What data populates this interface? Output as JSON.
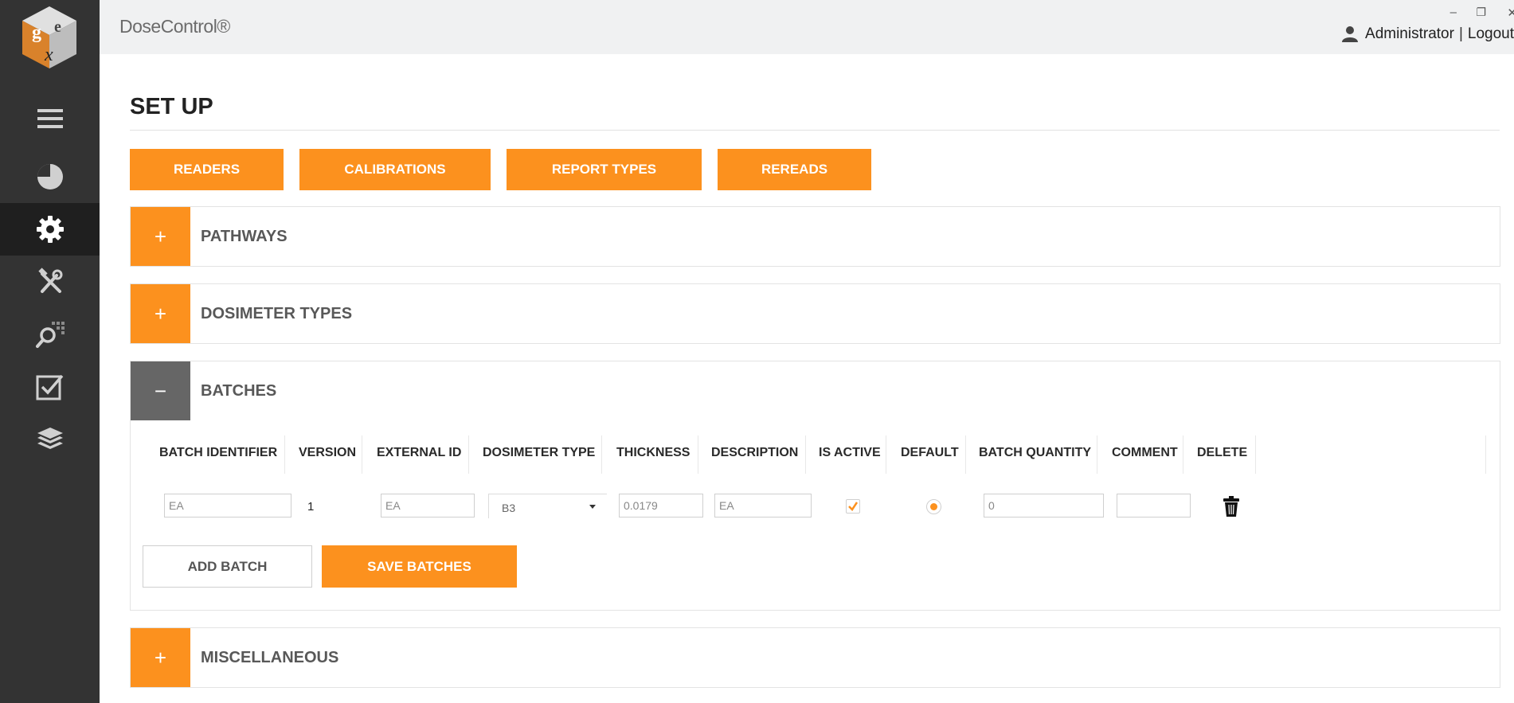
{
  "app": {
    "title": "DoseControl®"
  },
  "window": {
    "minimize": "–",
    "restore": "❐",
    "close": "✕"
  },
  "user": {
    "name": "Administrator",
    "separator": "|",
    "logout": "Logout"
  },
  "nav": [
    {
      "icon": "menu-icon"
    },
    {
      "icon": "pie-chart-icon"
    },
    {
      "icon": "gear-icon",
      "active": true
    },
    {
      "icon": "tools-icon"
    },
    {
      "icon": "search-grid-icon"
    },
    {
      "icon": "checklist-icon"
    },
    {
      "icon": "layers-icon"
    }
  ],
  "page": {
    "title": "SET UP"
  },
  "tabs": {
    "readers": "READERS",
    "calibrations": "CALIBRATIONS",
    "report_types": "REPORT TYPES",
    "rereads": "REREADS"
  },
  "panels": {
    "pathways": {
      "label": "PATHWAYS",
      "toggle": "+"
    },
    "dosimeter_types": {
      "label": "DOSIMETER TYPES",
      "toggle": "+"
    },
    "batches": {
      "label": "BATCHES",
      "toggle": "−"
    },
    "miscellaneous": {
      "label": "MISCELLANEOUS",
      "toggle": "+"
    }
  },
  "batches_table": {
    "headers": {
      "batch_identifier": "BATCH IDENTIFIER",
      "version": "VERSION",
      "external_id": "EXTERNAL ID",
      "dosimeter_type": "DOSIMETER TYPE",
      "thickness": "THICKNESS",
      "description": "DESCRIPTION",
      "is_active": "IS ACTIVE",
      "default": "DEFAULT",
      "batch_quantity": "BATCH QUANTITY",
      "comment": "COMMENT",
      "delete": "DELETE"
    },
    "row": {
      "batch_identifier": "EA",
      "version": "1",
      "external_id": "EA",
      "dosimeter_type": "B3",
      "thickness": "0.0179",
      "description": "EA",
      "is_active": true,
      "default": true,
      "batch_quantity": "0",
      "comment": ""
    }
  },
  "actions": {
    "add_batch": "ADD BATCH",
    "save_batches": "SAVE BATCHES"
  },
  "colors": {
    "accent": "#fc911e",
    "sidebar": "#333333",
    "sidebar_active": "#1f1f1f",
    "collapse_toggle": "#666666"
  }
}
